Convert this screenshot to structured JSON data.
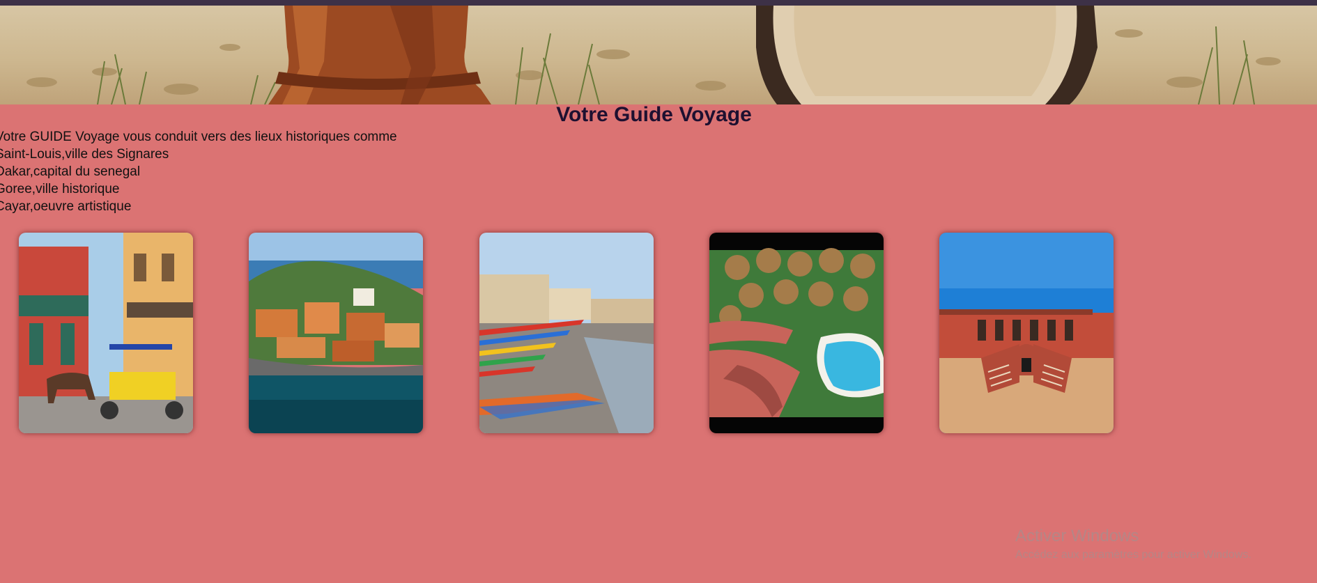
{
  "page": {
    "title": "Votre Guide Voyage",
    "intro_lines": [
      "Votre GUIDE Voyage vous conduit vers des lieux historiques comme",
      "Saint-Louis,ville des Signares",
      "Dakar,capital du senegal",
      "Goree,ville historique",
      "Cayar,oeuvre artistique"
    ]
  },
  "colors": {
    "background": "#db7373",
    "top_bar": "#3d3147",
    "title": "#1e1030"
  },
  "gallery": [
    {
      "subject": "street-with-horse-cart-image"
    },
    {
      "subject": "island-town-by-the-sea-image"
    },
    {
      "subject": "beach-with-fishing-boats-image"
    },
    {
      "subject": "resort-with-pool-image"
    },
    {
      "subject": "red-house-with-double-staircase-image"
    }
  ],
  "banner": {
    "subject": "drums-on-sand-banner-image"
  },
  "os_watermark": {
    "title": "Activer Windows",
    "subtitle": "Accédez aux paramètres pour activer Windows."
  }
}
